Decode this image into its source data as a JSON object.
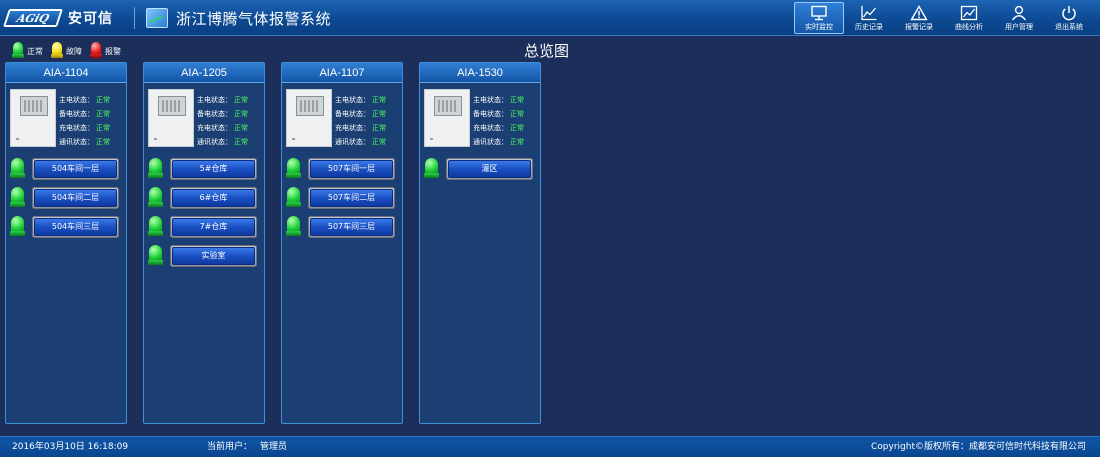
{
  "header": {
    "brand_mark": "AGiQ",
    "brand_name": "安可信",
    "system_title": "浙江博腾气体报警系统",
    "nav": [
      {
        "label": "实时监控",
        "icon": "monitor-icon",
        "active": true
      },
      {
        "label": "历史记录",
        "icon": "line-chart-icon",
        "active": false
      },
      {
        "label": "报警记录",
        "icon": "warning-icon",
        "active": false
      },
      {
        "label": "曲线分析",
        "icon": "analysis-chart-icon",
        "active": false
      },
      {
        "label": "用户管理",
        "icon": "user-icon",
        "active": false
      },
      {
        "label": "退出系统",
        "icon": "power-icon",
        "active": false
      }
    ]
  },
  "legend": [
    {
      "label": "正常",
      "color": "green"
    },
    {
      "label": "故障",
      "color": "yellow"
    },
    {
      "label": "报警",
      "color": "red"
    }
  ],
  "page_title": "总览图",
  "status_labels": {
    "main": "主电状态：",
    "backup": "备电状态：",
    "charge": "充电状态：",
    "comm": "通讯状态："
  },
  "panels": [
    {
      "name": "AIA-1104",
      "status": {
        "main": "正常",
        "backup": "正常",
        "charge": "正常",
        "comm": "正常"
      },
      "zones": [
        "504车间一层",
        "504车间二层",
        "504车间三层"
      ]
    },
    {
      "name": "AIA-1205",
      "status": {
        "main": "正常",
        "backup": "正常",
        "charge": "正常",
        "comm": "正常"
      },
      "zones": [
        "5#仓库",
        "6#仓库",
        "7#仓库",
        "实验室"
      ]
    },
    {
      "name": "AIA-1107",
      "status": {
        "main": "正常",
        "backup": "正常",
        "charge": "正常",
        "comm": "正常"
      },
      "zones": [
        "507车间一层",
        "507车间二层",
        "507车间三层"
      ]
    },
    {
      "name": "AIA-1530",
      "status": {
        "main": "正常",
        "backup": "正常",
        "charge": "正常",
        "comm": "正常"
      },
      "zones": [
        "灌区"
      ]
    }
  ],
  "footer": {
    "datetime": "2016年03月10日 16:18:09",
    "user_label": "当前用户：",
    "user_name": "管理员",
    "copyright": "Copyright©版权所有：成都安可信时代科技有限公司"
  }
}
